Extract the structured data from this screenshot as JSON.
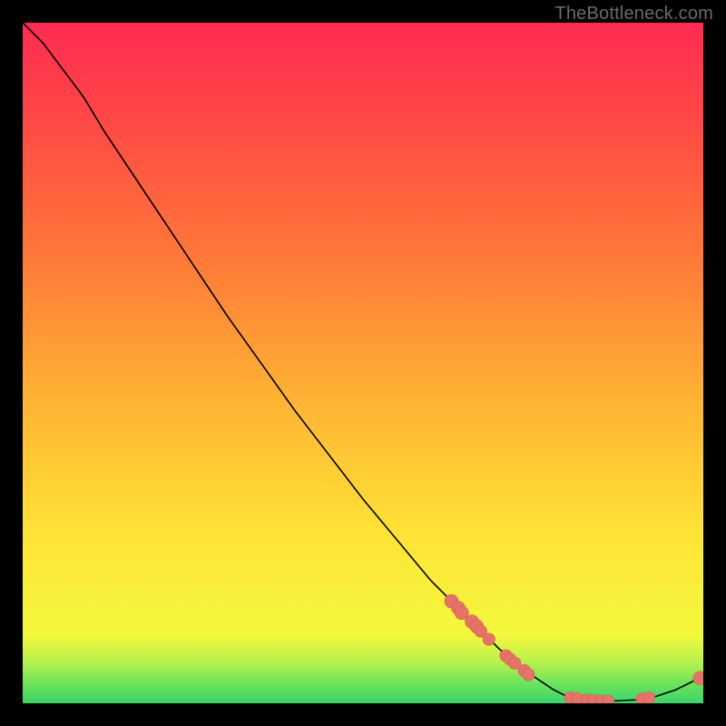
{
  "watermark": "TheBottleneck.com",
  "colors": {
    "bg_black": "#000000",
    "watermark_gray": "#6a6a6a",
    "line_black": "#000000",
    "marker_fill": "#e57368",
    "marker_stroke": "#d45a50"
  },
  "chart_data": {
    "type": "line",
    "title": "",
    "xlabel": "",
    "ylabel": "",
    "xlim": [
      0,
      100
    ],
    "ylim": [
      0,
      100
    ],
    "gradient_stops": [
      {
        "offset": 0,
        "color": "#3bd46a"
      },
      {
        "offset": 3,
        "color": "#6de35b"
      },
      {
        "offset": 6,
        "color": "#b6f24c"
      },
      {
        "offset": 10,
        "color": "#f3f83d"
      },
      {
        "offset": 25,
        "color": "#ffe336"
      },
      {
        "offset": 45,
        "color": "#ffb233"
      },
      {
        "offset": 65,
        "color": "#ff7a38"
      },
      {
        "offset": 85,
        "color": "#ff4a45"
      },
      {
        "offset": 100,
        "color": "#ff2b52"
      }
    ],
    "curve": [
      {
        "x": 0,
        "y": 100
      },
      {
        "x": 3,
        "y": 97
      },
      {
        "x": 6,
        "y": 93
      },
      {
        "x": 9,
        "y": 89
      },
      {
        "x": 12,
        "y": 84
      },
      {
        "x": 20,
        "y": 72
      },
      {
        "x": 30,
        "y": 57
      },
      {
        "x": 40,
        "y": 43
      },
      {
        "x": 50,
        "y": 30
      },
      {
        "x": 60,
        "y": 18
      },
      {
        "x": 65,
        "y": 13
      },
      {
        "x": 70,
        "y": 8
      },
      {
        "x": 75,
        "y": 4
      },
      {
        "x": 78,
        "y": 2
      },
      {
        "x": 80,
        "y": 1
      },
      {
        "x": 83,
        "y": 0.5
      },
      {
        "x": 86,
        "y": 0.3
      },
      {
        "x": 90,
        "y": 0.5
      },
      {
        "x": 93,
        "y": 1
      },
      {
        "x": 96,
        "y": 2
      },
      {
        "x": 100,
        "y": 4
      }
    ],
    "markers": [
      {
        "x": 63,
        "y": 15.0,
        "r": 1.0
      },
      {
        "x": 64,
        "y": 14.0,
        "r": 1.0
      },
      {
        "x": 64.5,
        "y": 13.3,
        "r": 1.0
      },
      {
        "x": 66,
        "y": 12.0,
        "r": 1.0
      },
      {
        "x": 66.7,
        "y": 11.3,
        "r": 1.0
      },
      {
        "x": 67.3,
        "y": 10.6,
        "r": 0.9
      },
      {
        "x": 68.5,
        "y": 9.4,
        "r": 0.9
      },
      {
        "x": 71,
        "y": 7.0,
        "r": 0.9
      },
      {
        "x": 71.6,
        "y": 6.5,
        "r": 0.9
      },
      {
        "x": 72.3,
        "y": 5.9,
        "r": 0.9
      },
      {
        "x": 73.7,
        "y": 4.8,
        "r": 0.9
      },
      {
        "x": 74.3,
        "y": 4.2,
        "r": 0.9
      },
      {
        "x": 80.5,
        "y": 0.8,
        "r": 0.9
      },
      {
        "x": 81.5,
        "y": 0.7,
        "r": 0.9
      },
      {
        "x": 83,
        "y": 0.5,
        "r": 0.9
      },
      {
        "x": 83.8,
        "y": 0.4,
        "r": 0.9
      },
      {
        "x": 85,
        "y": 0.35,
        "r": 0.9
      },
      {
        "x": 86,
        "y": 0.3,
        "r": 0.9
      },
      {
        "x": 91,
        "y": 0.6,
        "r": 0.9
      },
      {
        "x": 92,
        "y": 0.8,
        "r": 0.9
      },
      {
        "x": 99.5,
        "y": 3.7,
        "r": 1.0
      }
    ]
  }
}
